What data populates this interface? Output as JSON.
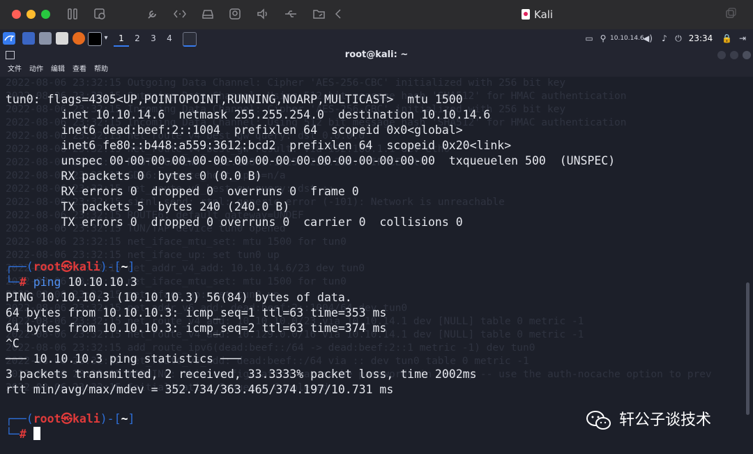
{
  "vm_toolbar": {
    "title": "Kali",
    "icons": [
      "pause-icon",
      "snapshot-icon",
      "wrench-icon",
      "code-icon",
      "disk-icon",
      "camera-icon",
      "speaker-icon",
      "usb-icon",
      "folder-share-icon",
      "back-icon",
      "window-icon"
    ]
  },
  "kali_panel": {
    "workspaces": [
      "1",
      "2",
      "3",
      "4"
    ],
    "ip": "10.10.14.6",
    "clock": "23:34"
  },
  "terminal": {
    "title": "root@kali: ~",
    "menu": [
      "文件",
      "动作",
      "编辑",
      "查看",
      "帮助"
    ],
    "lines": {
      "l1": "tun0: flags=4305<UP,POINTOPOINT,RUNNING,NOARP,MULTICAST>  mtu 1500",
      "l2": "        inet 10.10.14.6  netmask 255.255.254.0  destination 10.10.14.6",
      "l3": "        inet6 dead:beef:2::1004  prefixlen 64  scopeid 0x0<global>",
      "l4": "        inet6 fe80::b448:a559:3612:bcd2  prefixlen 64  scopeid 0x20<link>",
      "l5": "        unspec 00-00-00-00-00-00-00-00-00-00-00-00-00-00-00-00  txqueuelen 500  (UNSPEC)",
      "l6": "        RX packets 0  bytes 0 (0.0 B)",
      "l7": "        RX errors 0  dropped 0  overruns 0  frame 0",
      "l8": "        TX packets 5  bytes 240 (240.0 B)",
      "l9": "        TX errors 0  dropped 0 overruns 0  carrier 0  collisions 0",
      "p1_open": "┌──(",
      "p_user": "root",
      "p_at": "㉿",
      "p_host": "kali",
      "p_mid": ")-[",
      "p_dir": "~",
      "p_close": "]",
      "p_hash_prefix": "└─",
      "p_hash": "#",
      "cmd1": " ping",
      "cmd1_args": " 10.10.10.3",
      "o1": "PING 10.10.10.3 (10.10.10.3) 56(84) bytes of data.",
      "o2": "64 bytes from 10.10.10.3: icmp_seq=1 ttl=63 time=353 ms",
      "o3": "64 bytes from 10.10.10.3: icmp_seq=2 ttl=63 time=374 ms",
      "o4": "^C",
      "o5": "─── 10.10.10.3 ping statistics ───",
      "o6": "3 packets transmitted, 2 received, 33.3333% packet loss, time 2002ms",
      "o7": "rtt min/avg/max/mdev = 352.734/363.465/374.197/10.731 ms"
    },
    "background_log": "2022-08-06 23:32:15 Outgoing Data Channel: Cipher 'AES-256-CBC' initialized with 256 bit key\n2022-08-06 23:32:15 Outgoing Data Channel: Using 512 bit message hash 'SHA512' for HMAC authentication\n2022-08-06 23:32:15 Incoming Data Channel: Cipher 'AES-256-CBC' initialized with 256 bit key\n2022-08-06 23:32:15 Incoming Data Channel: Using 512 bit message hash 'SHA512' for HMAC authentication\n2022-08-06 23:32:15 net_route_v4_best_gw query: dst 0.0.0.0\n2022-08-06 23:32:15 net_route_v4_best_gw result: via 192.168.1.1 dev eth0\n2022-08-06 23:32:15 ROUTE_GATEWAY 192.168.1.1/255.255.255.0 IFACE=eth0\n2022-08-06 23:32:15 GDG6: remote_host_ipv6=n/a\n2022-08-06 23:32:15 net_route_v6_best_gw query: dst ::\n2022-08-06 23:32:15 sitnl_send: rtnl: generic error (-101): Network is unreachable\n2022-08-06 23:32:15 ROUTE6: default_gateway=UNDEF\n2022-08-06 23:32:15 TUN/TAP device tun0 opened\n2022-08-06 23:32:15 net_iface_mtu_set: mtu 1500 for tun0\n2022-08-06 23:32:15 net_iface_up: set tun0 up\n2022-08-06 23:32:15 net_addr_v4_add: 10.10.14.6/23 dev tun0\n2022-08-06 23:32:15 net_iface_mtu_set: mtu 1500 for tun0\n2022-08-06 23:32:15 net_iface_up: set tun0 up\n2022-08-06 23:32:15 net_addr_v6_add: dead:beef:2::1004/64 dev tun0\n2022-08-06 23:32:15 net_route_v4_add: 10.10.10.0/23 via 10.10.14.1 dev [NULL] table 0 metric -1\n2022-08-06 23:32:15 net_route_v4_add: 10.129.0.0/16 via 10.10.14.1 dev [NULL] table 0 metric -1\n2022-08-06 23:32:15 add_route_ipv6(dead:beef::/64 -> dead:beef:2::1 metric -1) dev tun0\n2022-08-06 23:32:15 net_route_v6_add: dead:beef::/64 via :: dev tun0 table 0 metric -1\n2022-08-06 23:32:15 WARNING: this configuration may cache passwords in memory -- use the auth-nocache option to prev\n2022-08-06 23:32:15 Initialization Sequence Completed"
  },
  "watermark": {
    "text": "轩公子谈技术"
  }
}
